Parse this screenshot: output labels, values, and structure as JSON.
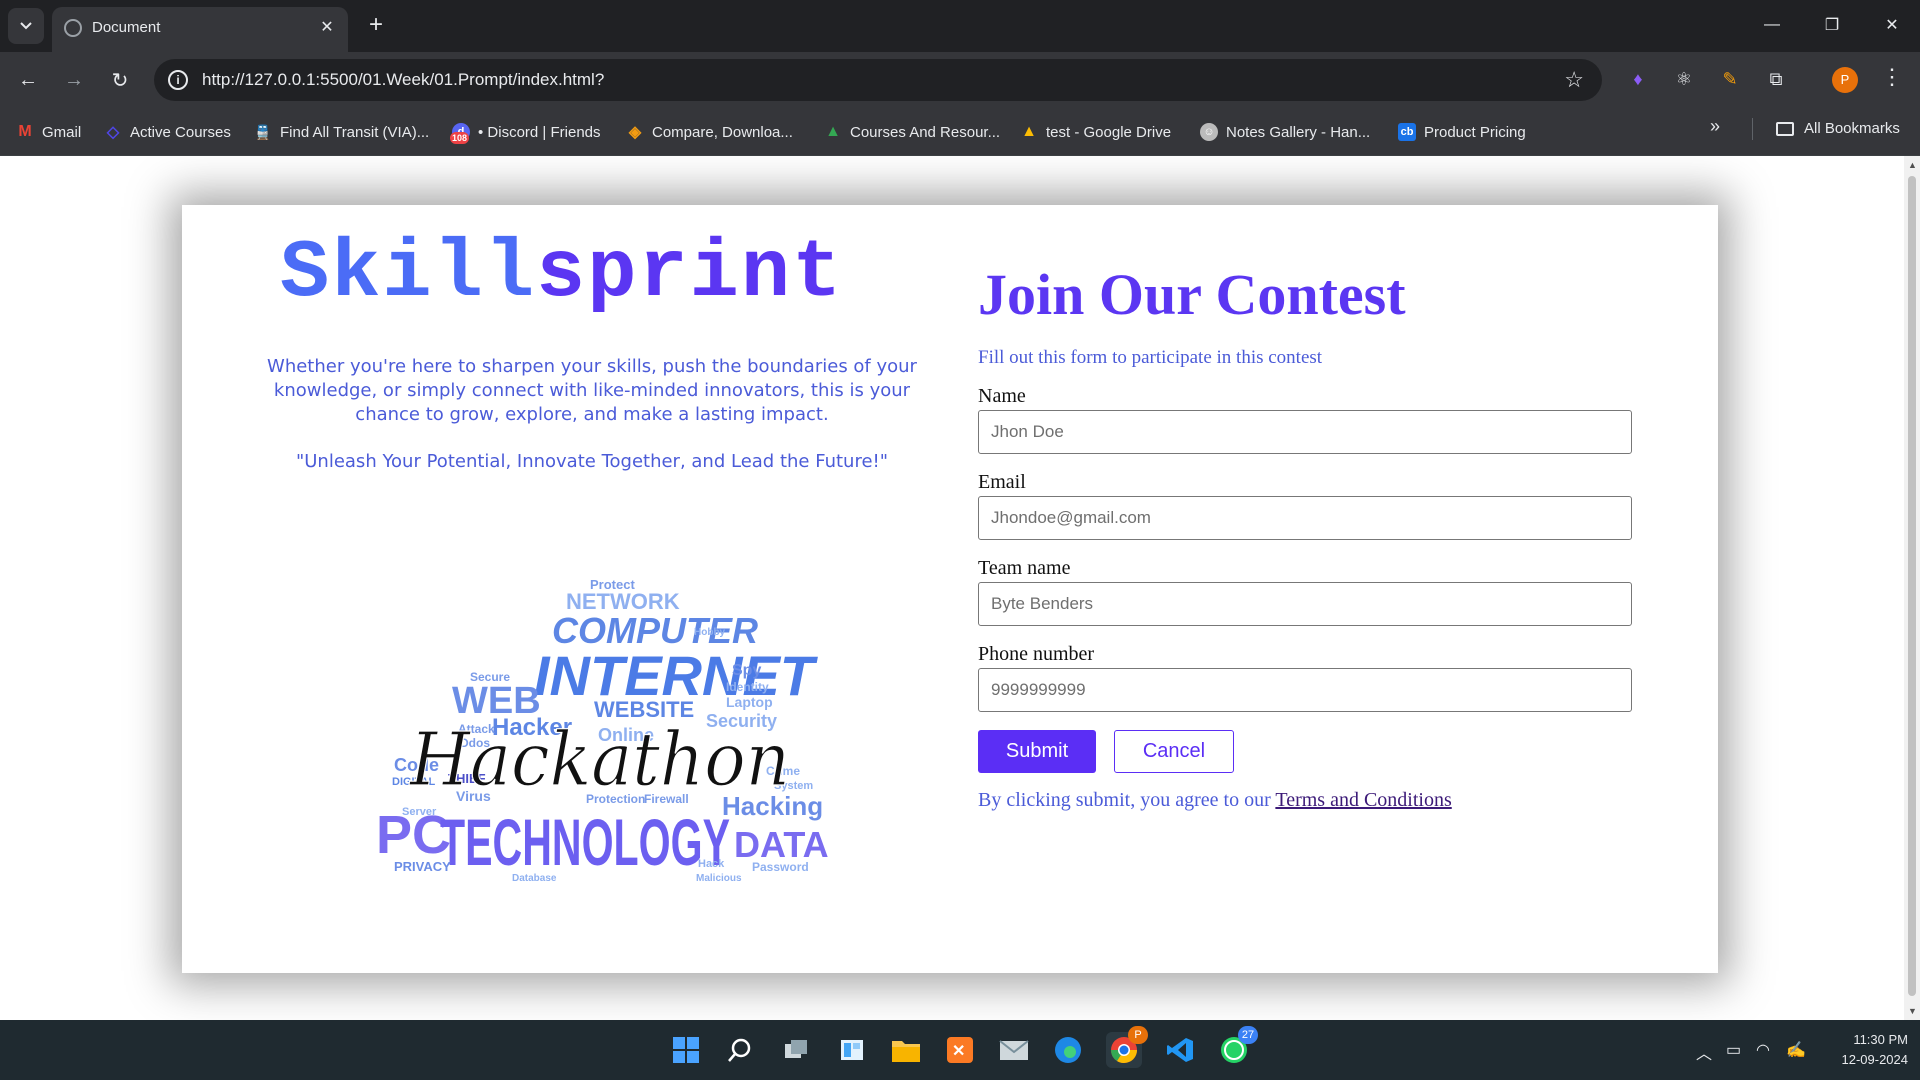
{
  "browser": {
    "tab_title": "Document",
    "url": "http://127.0.0.1:5500/01.Week/01.Prompt/index.html?",
    "profile_initial": "P",
    "bookmarks": [
      {
        "label": "Gmail",
        "icon": "gmail-icon",
        "color": "#ea4335"
      },
      {
        "label": "Active Courses",
        "icon": "code-icon",
        "color": "#4f46e5"
      },
      {
        "label": "Find All Transit (VIA)...",
        "icon": "transit-icon",
        "color": "#c0392b"
      },
      {
        "label": "• Discord | Friends",
        "icon": "discord-icon",
        "color": "#5865f2"
      },
      {
        "label": "Compare, Downloa...",
        "icon": "diamond-icon",
        "color": "#f39c12"
      },
      {
        "label": "Courses And Resour...",
        "icon": "google-drive-icon",
        "color": "#34a853"
      },
      {
        "label": "test - Google Drive",
        "icon": "google-drive-icon",
        "color": "#34a853"
      },
      {
        "label": "Notes Gallery - Han...",
        "icon": "avatar-icon",
        "color": "#888888"
      },
      {
        "label": "Product Pricing",
        "icon": "cb-icon",
        "color": "#1a73e8"
      }
    ],
    "all_bookmarks": "All Bookmarks",
    "discord_badge": "108"
  },
  "page": {
    "brand_part1": "Skill",
    "brand_part2": "sprint",
    "intro": "Whether you're here to sharpen your skills, push the boundaries of your knowledge, or simply connect with like-minded innovators, this is your chance to grow, explore, and make a lasting impact.",
    "quote": "\"Unleash Your Potential, Innovate Together, and Lead the Future!\"",
    "wordcloud": {
      "script": "Hackathon",
      "big": [
        "TECHNOLOGY",
        "INTERNET",
        "COMPUTER",
        "NETWORK",
        "WEB",
        "PC",
        "DATA",
        "Hacking",
        "Hacker",
        "WEBSITE"
      ],
      "small": [
        "Protect",
        "Spy",
        "Identity",
        "Laptop",
        "Security",
        "Online",
        "Secure",
        "Attack",
        "Ddos",
        "Code",
        "DIGITAL",
        "THIEF",
        "Virus",
        "PRIVACY",
        "Crime",
        "System",
        "Password",
        "Protection",
        "Firewall",
        "Malicious",
        "Database",
        "Hack",
        "Server",
        "Hobby"
      ]
    },
    "form": {
      "title": "Join Our Contest",
      "subtitle": "Fill out this form to participate in this contest",
      "name_label": "Name",
      "name_placeholder": "Jhon Doe",
      "email_label": "Email",
      "email_placeholder": "Jhondoe@gmail.com",
      "team_label": "Team name",
      "team_placeholder": "Byte Benders",
      "phone_label": "Phone number",
      "phone_placeholder": "9999999999",
      "submit": "Submit",
      "cancel": "Cancel",
      "terms_prefix": "By clicking submit, you agree to our ",
      "terms_link": "Terms and Conditions"
    },
    "colors": {
      "brand_blue": "#4b6cf6",
      "brand_purple": "#5b36f2",
      "accent": "#5b2ef5"
    }
  },
  "taskbar": {
    "time": "11:30 PM",
    "date": "12-09-2024",
    "whatsapp_badge": "27",
    "chrome_badge": "P"
  }
}
